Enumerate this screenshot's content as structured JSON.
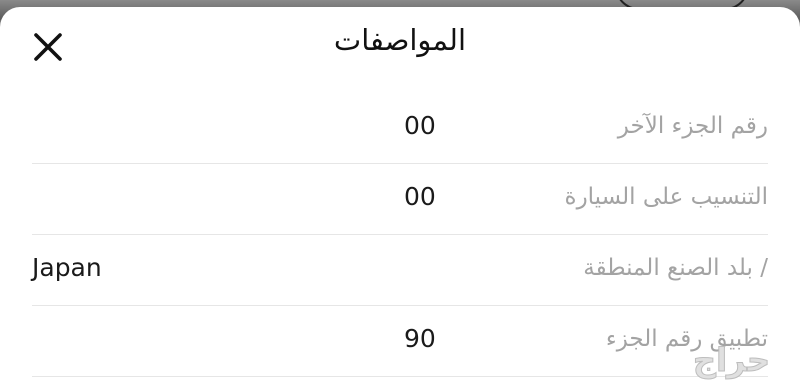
{
  "dialog": {
    "title": "المواصفات"
  },
  "specs": [
    {
      "label": "رقم الجزء الآخر",
      "value": "00"
    },
    {
      "label": "التنسيب على السيارة",
      "value": "00"
    },
    {
      "label": "/ بلد الصنع المنطقة",
      "value": "Japan"
    },
    {
      "label": "تطبيق رقم الجزء",
      "value": "90"
    }
  ],
  "watermark": "حراج",
  "icons": {
    "close": "close-icon"
  },
  "colors": {
    "label": "#a3a3a3",
    "value": "#1a1a1a",
    "divider": "#e6e6e6",
    "backdrop": "#6e6e6e"
  }
}
